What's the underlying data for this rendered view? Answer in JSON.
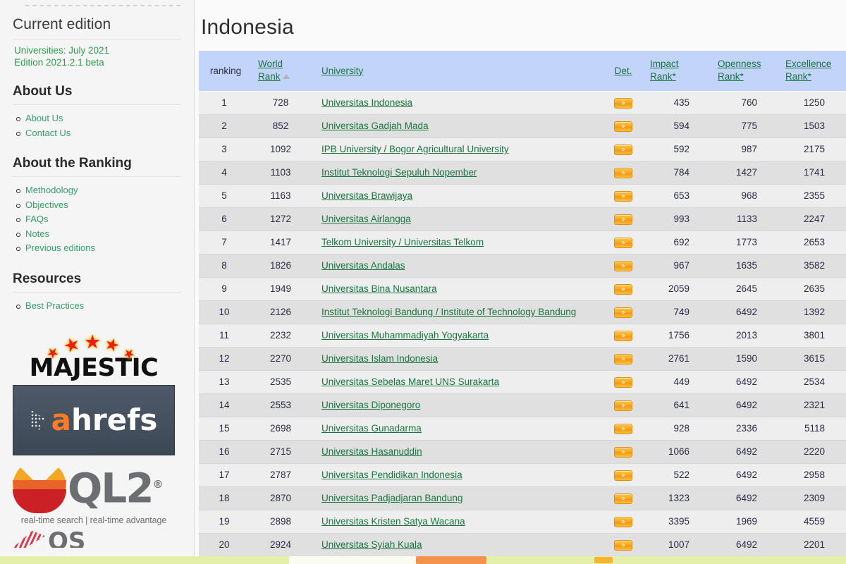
{
  "sidebar": {
    "title": "Current edition",
    "edition_line1": "Universities: July 2021",
    "edition_line2": "Edition 2021.2.1 beta",
    "sections": [
      {
        "heading": "About Us",
        "items": [
          {
            "label": "About Us"
          },
          {
            "label": "Contact Us"
          }
        ]
      },
      {
        "heading": "About the Ranking",
        "items": [
          {
            "label": "Methodology"
          },
          {
            "label": "Objectives"
          },
          {
            "label": "FAQs"
          },
          {
            "label": "Notes"
          },
          {
            "label": "Previous editions"
          }
        ]
      },
      {
        "heading": "Resources",
        "items": [
          {
            "label": "Best Practices"
          }
        ]
      }
    ],
    "sponsors": [
      {
        "name": "majestic",
        "word": "MAJESTIC"
      },
      {
        "name": "ahrefs",
        "word_a": "a",
        "word_rest": "hrefs"
      },
      {
        "name": "ql2",
        "word": "QL2",
        "registered": "®",
        "tagline": "real-time search | real-time advantage"
      },
      {
        "name": "partial-logo",
        "word": "QS"
      }
    ]
  },
  "main": {
    "page_title": "Indonesia",
    "table": {
      "headers": {
        "ranking": "ranking",
        "world_rank_l1": "World",
        "world_rank_l2": "Rank",
        "university": "University",
        "det": "Det.",
        "impact_l1": "Impact",
        "impact_l2": "Rank*",
        "openness_l1": "Openness",
        "openness_l2": "Rank*",
        "excellence_l1": "Excellence",
        "excellence_l2": "Rank*"
      },
      "sort_column": "World Rank",
      "sort_direction": "ascending",
      "detail_button_glyph": "»",
      "rows": [
        {
          "ranking": "1",
          "world_rank": "728",
          "university": "Universitas Indonesia",
          "impact": "435",
          "openness": "760",
          "excellence": "1250"
        },
        {
          "ranking": "2",
          "world_rank": "852",
          "university": "Universitas Gadjah Mada",
          "impact": "594",
          "openness": "775",
          "excellence": "1503"
        },
        {
          "ranking": "3",
          "world_rank": "1092",
          "university": "IPB University / Bogor Agricultural University",
          "impact": "592",
          "openness": "987",
          "excellence": "2175"
        },
        {
          "ranking": "4",
          "world_rank": "1103",
          "university": "Institut Teknologi Sepuluh Nopember",
          "impact": "784",
          "openness": "1427",
          "excellence": "1741"
        },
        {
          "ranking": "5",
          "world_rank": "1163",
          "university": "Universitas Brawijaya",
          "impact": "653",
          "openness": "968",
          "excellence": "2355"
        },
        {
          "ranking": "6",
          "world_rank": "1272",
          "university": "Universitas Airlangga",
          "impact": "993",
          "openness": "1133",
          "excellence": "2247"
        },
        {
          "ranking": "7",
          "world_rank": "1417",
          "university": "Telkom University / Universitas Telkom",
          "impact": "692",
          "openness": "1773",
          "excellence": "2653"
        },
        {
          "ranking": "8",
          "world_rank": "1826",
          "university": "Universitas Andalas",
          "impact": "967",
          "openness": "1635",
          "excellence": "3582"
        },
        {
          "ranking": "9",
          "world_rank": "1949",
          "university": "Universitas Bina Nusantara",
          "impact": "2059",
          "openness": "2645",
          "excellence": "2635"
        },
        {
          "ranking": "10",
          "world_rank": "2126",
          "university": "Institut Teknologi Bandung / Institute of Technology Bandung",
          "impact": "749",
          "openness": "6492",
          "excellence": "1392"
        },
        {
          "ranking": "11",
          "world_rank": "2232",
          "university": "Universitas Muhammadiyah Yogyakarta",
          "impact": "1756",
          "openness": "2013",
          "excellence": "3801"
        },
        {
          "ranking": "12",
          "world_rank": "2270",
          "university": "Universitas Islam Indonesia",
          "impact": "2761",
          "openness": "1590",
          "excellence": "3615"
        },
        {
          "ranking": "13",
          "world_rank": "2535",
          "university": "Universitas Sebelas Maret UNS Surakarta",
          "impact": "449",
          "openness": "6492",
          "excellence": "2534"
        },
        {
          "ranking": "14",
          "world_rank": "2553",
          "university": "Universitas Diponegoro",
          "impact": "641",
          "openness": "6492",
          "excellence": "2321"
        },
        {
          "ranking": "15",
          "world_rank": "2698",
          "university": "Universitas Gunadarma",
          "impact": "928",
          "openness": "2336",
          "excellence": "5118"
        },
        {
          "ranking": "16",
          "world_rank": "2715",
          "university": "Universitas Hasanuddin",
          "impact": "1066",
          "openness": "6492",
          "excellence": "2220"
        },
        {
          "ranking": "17",
          "world_rank": "2787",
          "university": "Universitas Pendidikan Indonesia",
          "impact": "522",
          "openness": "6492",
          "excellence": "2958"
        },
        {
          "ranking": "18",
          "world_rank": "2870",
          "university": "Universitas Padjadjaran Bandung",
          "impact": "1323",
          "openness": "6492",
          "excellence": "2309"
        },
        {
          "ranking": "19",
          "world_rank": "2898",
          "university": "Universitas Kristen Satya Wacana",
          "impact": "3395",
          "openness": "1969",
          "excellence": "4559"
        },
        {
          "ranking": "20",
          "world_rank": "2924",
          "university": "Universitas Syiah Kuala",
          "impact": "1007",
          "openness": "6492",
          "excellence": "2201"
        }
      ]
    }
  }
}
